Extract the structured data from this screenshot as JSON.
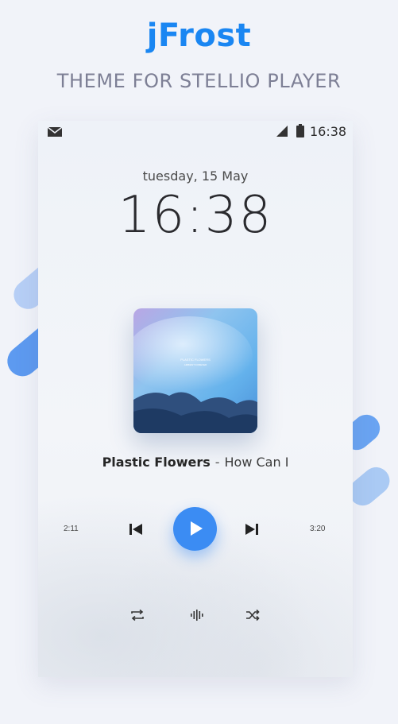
{
  "header": {
    "title": "jFrost",
    "subtitle": "THEME FOR STELLIO PLAYER"
  },
  "status_bar": {
    "time": "16:38",
    "icons": [
      "mail-icon",
      "signal-icon",
      "battery-icon"
    ]
  },
  "lockscreen": {
    "date": "tuesday, 15 May",
    "clock": "16:38"
  },
  "album": {
    "cover_text": [
      "PLASTIC FLOWERS",
      "AMBIENT FOREVER"
    ]
  },
  "track": {
    "title": "Plastic Flowers",
    "separator": "-",
    "artist": "How Can I"
  },
  "player": {
    "elapsed": "2:11",
    "total": "3:20",
    "controls": [
      "prev-icon",
      "play-icon",
      "next-icon"
    ],
    "extra_controls": [
      "repeat-icon",
      "equalizer-icon",
      "shuffle-icon"
    ]
  },
  "colors": {
    "accent": "#3b8cf3",
    "title": "#1a86f2",
    "subtitle": "#7d7f95",
    "background": "#f1f3f9"
  }
}
